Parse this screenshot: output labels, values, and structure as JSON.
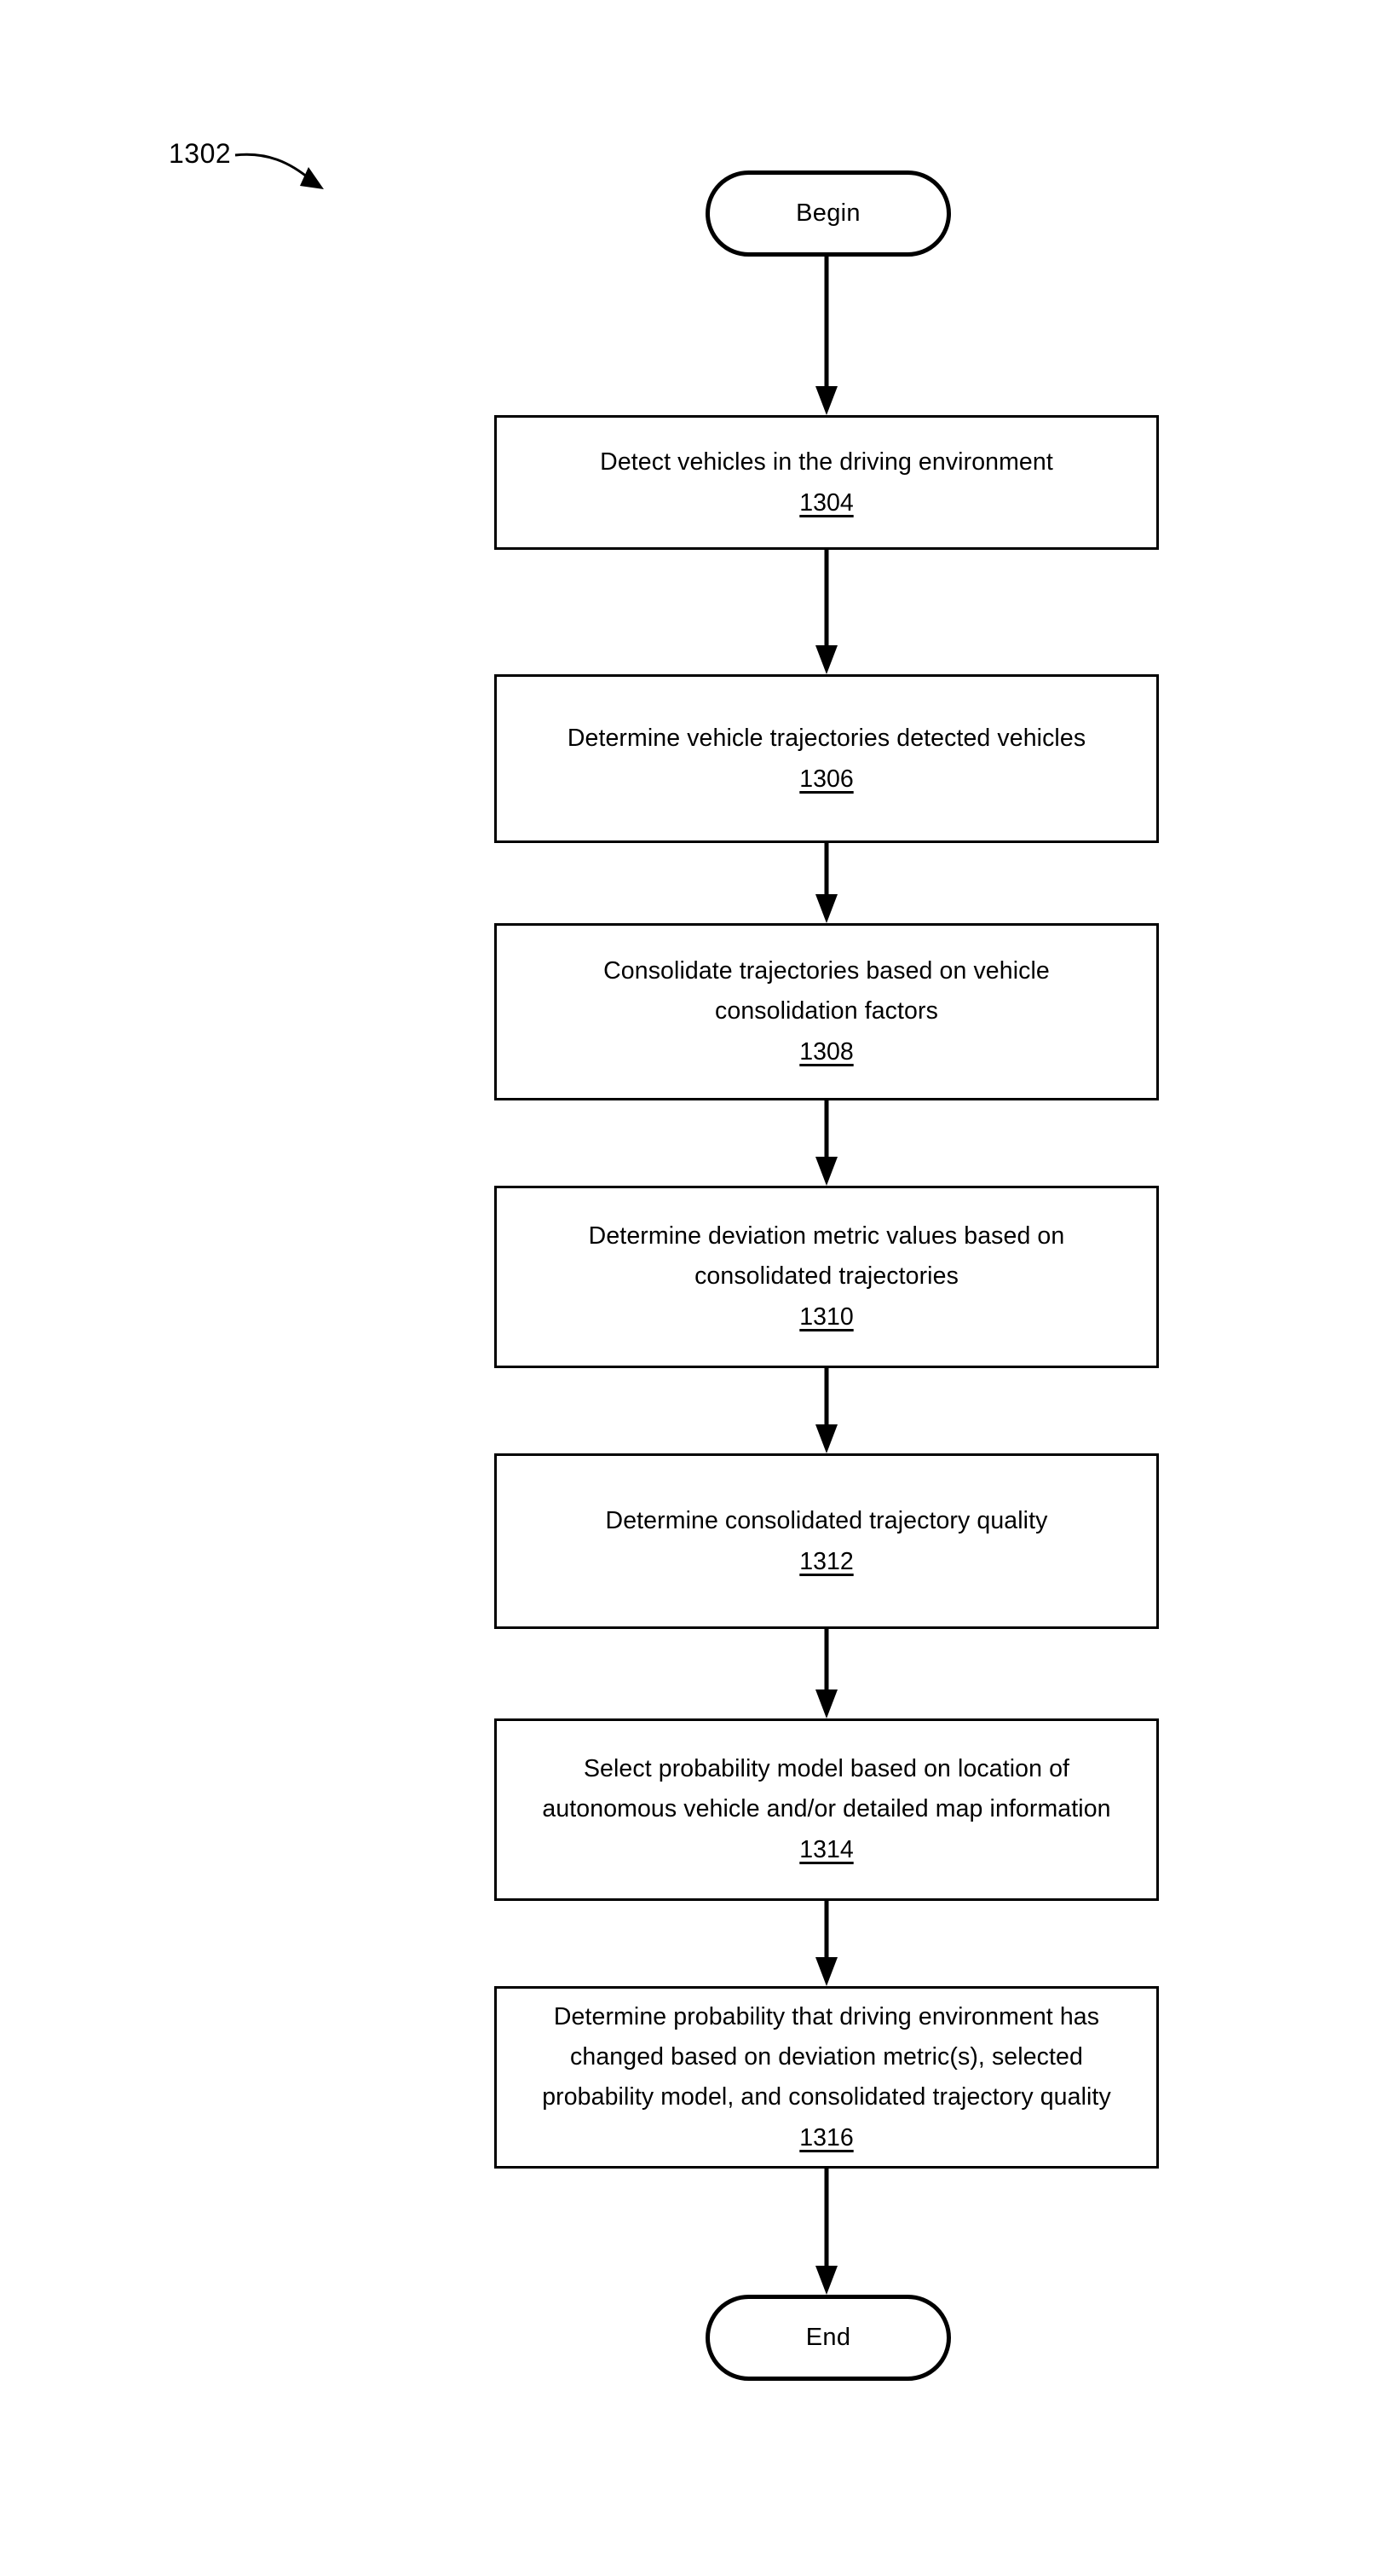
{
  "figure": {
    "reference_numeral": "1302",
    "leader_icon": "curved-leader-arrow-icon"
  },
  "flowchart": {
    "start_terminal": {
      "label": "Begin"
    },
    "end_terminal": {
      "label": "End"
    },
    "steps": [
      {
        "text": "Detect vehicles in the driving environment",
        "ref": "1304"
      },
      {
        "text": "Determine vehicle trajectories detected vehicles",
        "ref": "1306"
      },
      {
        "text": "Consolidate trajectories based on vehicle\nconsolidation factors",
        "ref": "1308"
      },
      {
        "text": "Determine deviation metric values based on\nconsolidated trajectories",
        "ref": "1310"
      },
      {
        "text": "Determine consolidated trajectory quality",
        "ref": "1312"
      },
      {
        "text": "Select probability model based on location of\nautonomous vehicle and/or detailed map information",
        "ref": "1314"
      },
      {
        "text": "Determine probability that driving environment has\nchanged based on deviation metric(s), selected\nprobability model, and consolidated trajectory quality",
        "ref": "1316"
      }
    ],
    "connector_count": 8,
    "connector_icon": "down-arrow-icon"
  },
  "style": {
    "stroke_color": "#000000",
    "background_color": "#ffffff"
  }
}
